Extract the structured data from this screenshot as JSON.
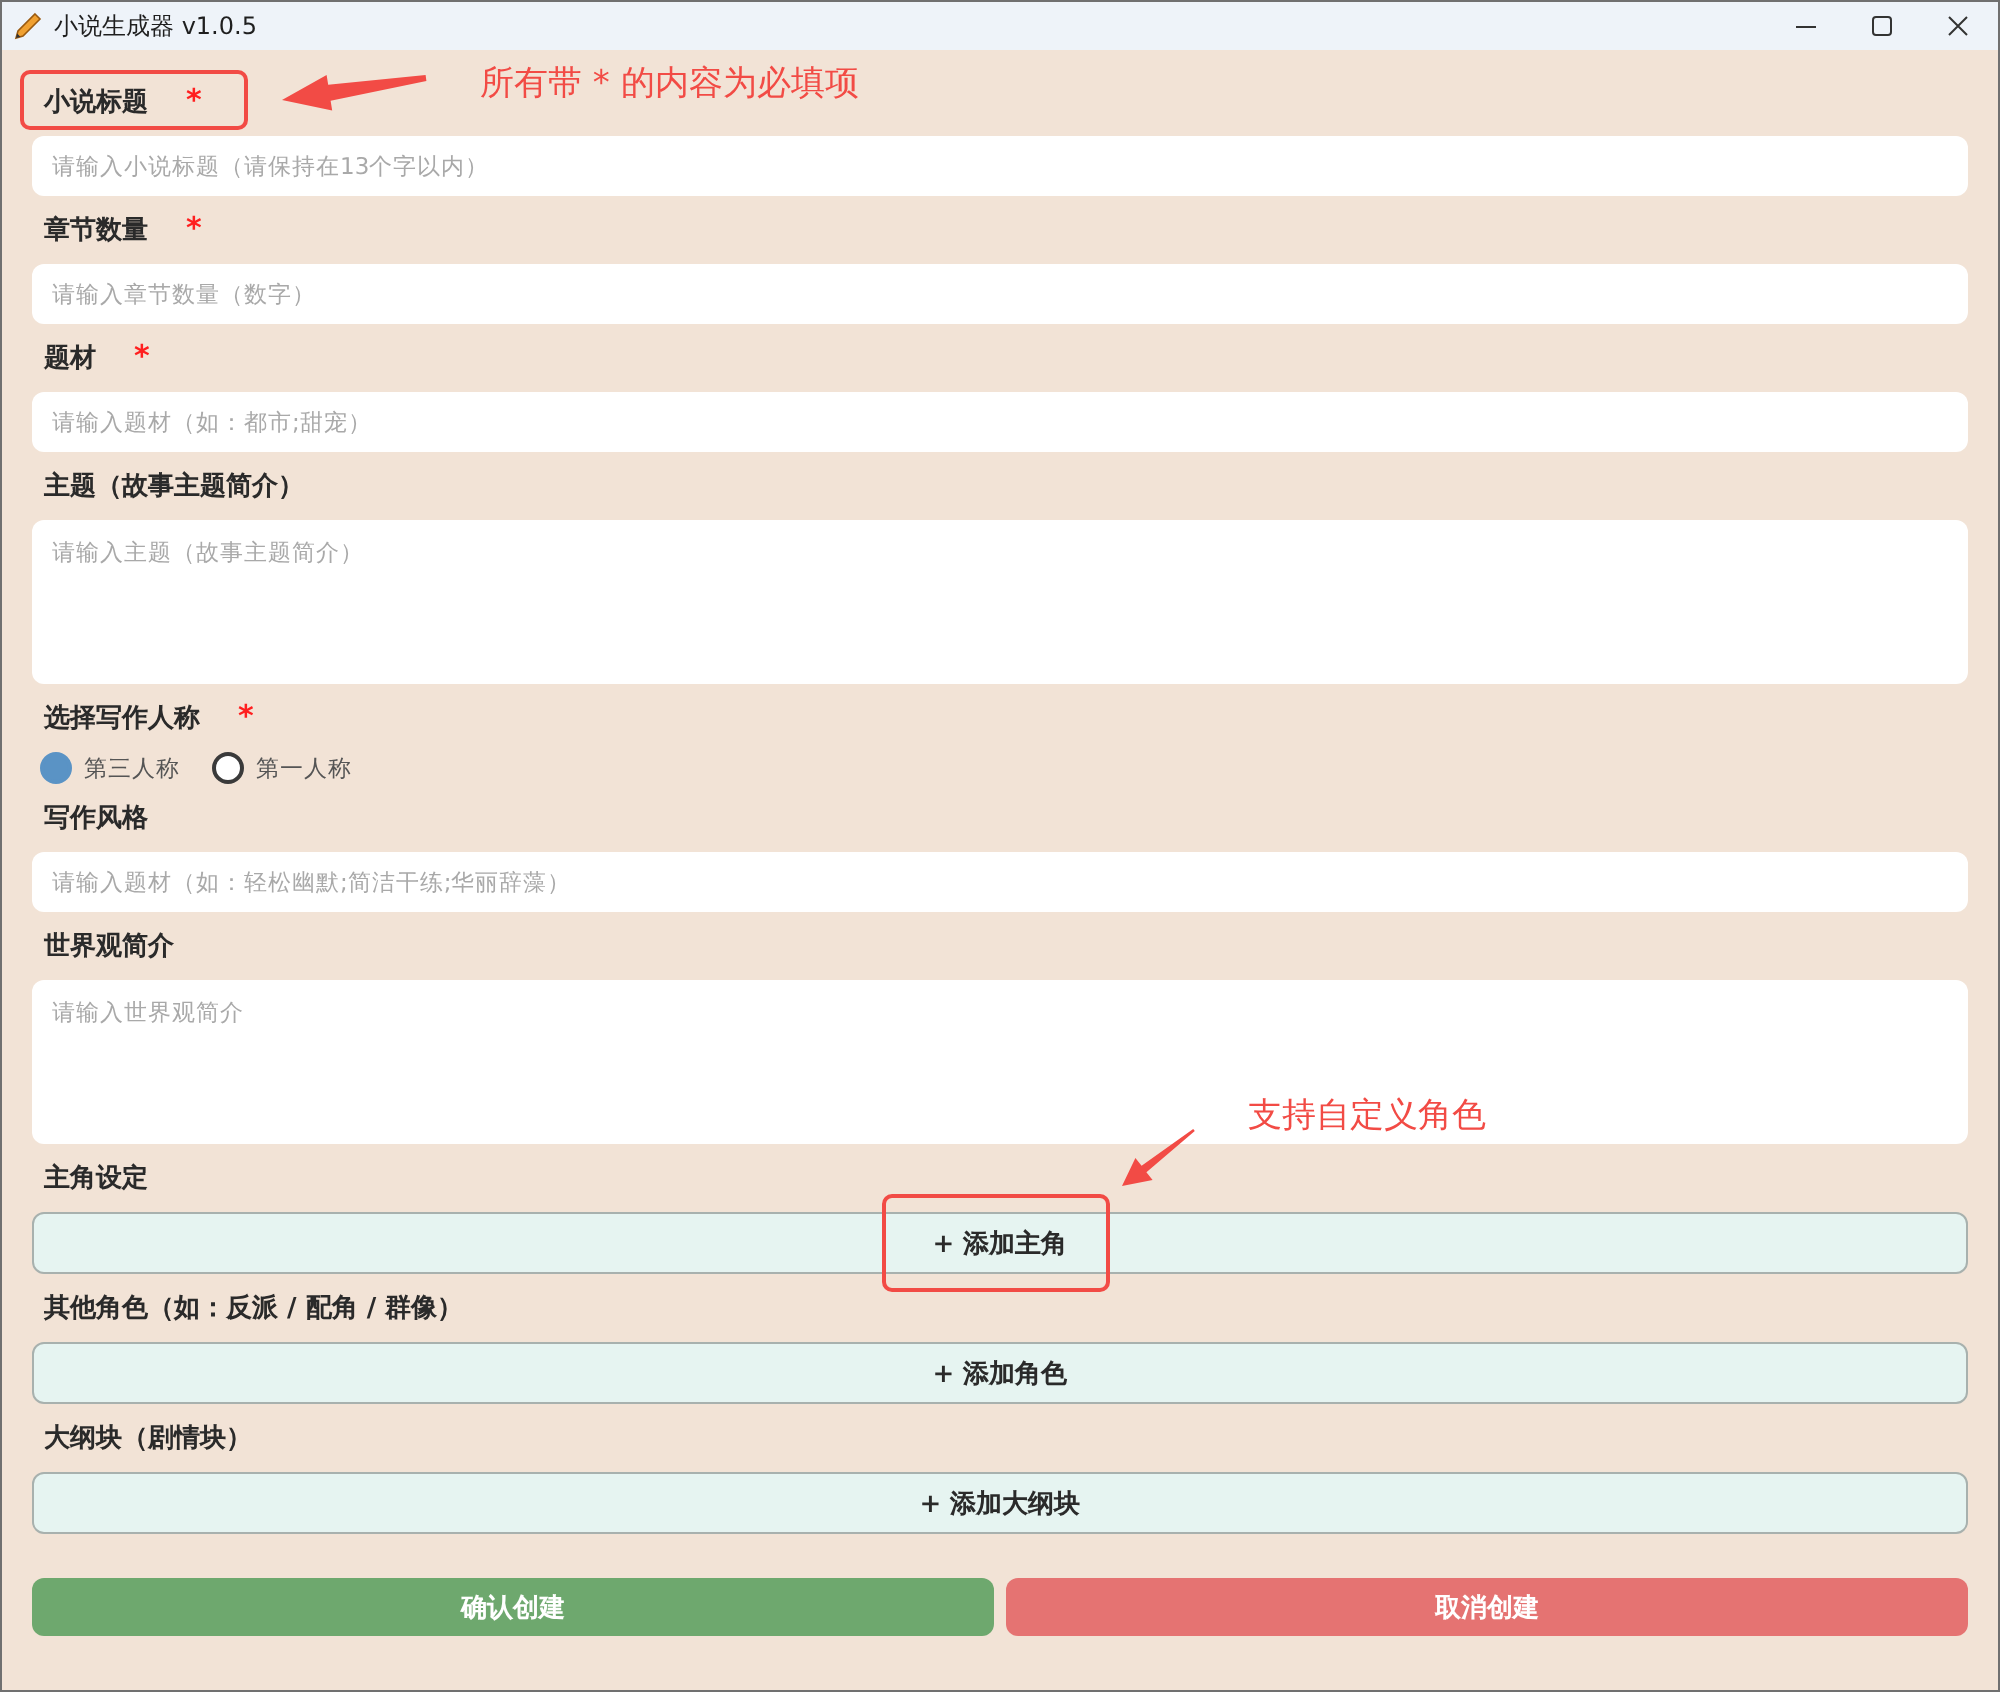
{
  "window": {
    "title": "小说生成器 v1.0.5"
  },
  "form": {
    "fields": [
      {
        "kind": "input",
        "label": "小说标题",
        "required_mark": "*",
        "placeholder": "请输入小说标题（请保持在13个字以内）",
        "highlighted": true,
        "callout": "所有带 * 的内容为必填项"
      },
      {
        "kind": "input",
        "label": "章节数量",
        "required_mark": "*",
        "placeholder": "请输入章节数量（数字）"
      },
      {
        "kind": "input",
        "label": "题材",
        "required_mark": "*",
        "placeholder": "请输入题材（如：都市;甜宠）"
      },
      {
        "kind": "textarea",
        "label": "主题（故事主题简介）",
        "placeholder": "请输入主题（故事主题简介）"
      },
      {
        "kind": "radio",
        "label": "选择写作人称",
        "required_mark": "*",
        "options": [
          {
            "label": "第三人称",
            "selected": true
          },
          {
            "label": "第一人称",
            "selected": false
          }
        ]
      },
      {
        "kind": "input",
        "label": "写作风格",
        "placeholder": "请输入题材（如：轻松幽默;简洁干练;华丽辞藻）"
      },
      {
        "kind": "textarea",
        "label": "世界观简介",
        "placeholder": "请输入世界观简介"
      },
      {
        "kind": "add",
        "label": "主角设定",
        "button": "+ 添加主角",
        "highlighted": true,
        "callout": "支持自定义角色"
      },
      {
        "kind": "add",
        "label": "其他角色（如：反派 / 配角 / 群像）",
        "button": "+ 添加角色"
      },
      {
        "kind": "add",
        "label": "大纲块（剧情块）",
        "button": "+ 添加大纲块"
      }
    ]
  },
  "actions": [
    {
      "kind": "confirm",
      "label": "确认创建"
    },
    {
      "kind": "cancel",
      "label": "取消创建"
    }
  ]
}
